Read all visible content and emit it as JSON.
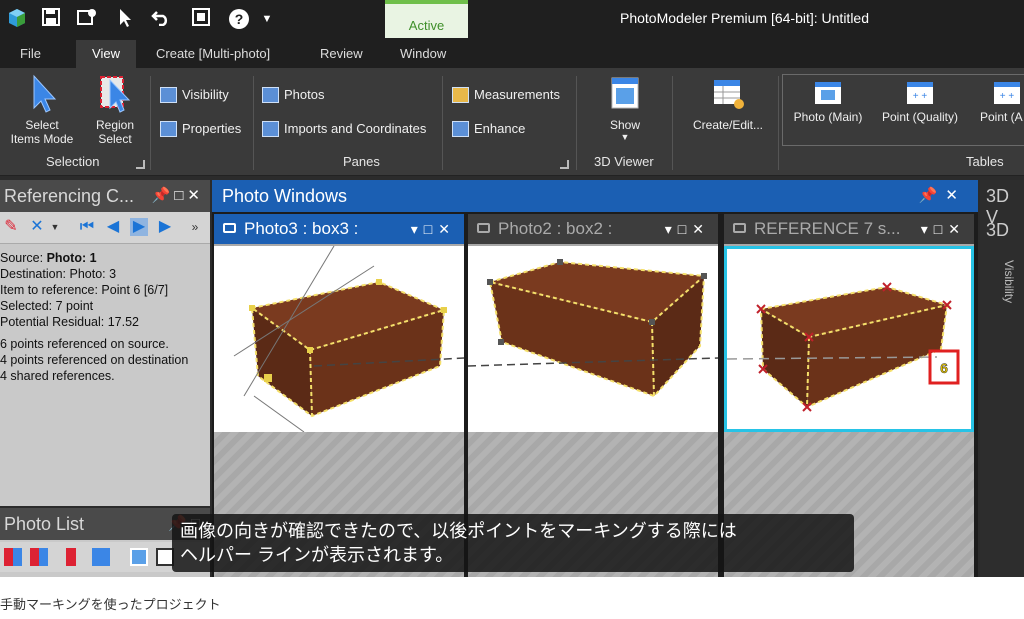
{
  "window": {
    "title": "PhotoModeler Premium [64-bit]: Untitled",
    "context_tab": "Active"
  },
  "quick_access": [
    "app-logo-icon",
    "save-icon",
    "save-photo-icon",
    "pointer-icon",
    "undo-icon",
    "window-icon",
    "help-icon",
    "dropdown-icon"
  ],
  "menu": {
    "tabs": [
      {
        "label": "File"
      },
      {
        "label": "View"
      },
      {
        "label": "Create  [Multi-photo]"
      },
      {
        "label": "Review"
      },
      {
        "label": "Window"
      }
    ],
    "selected": "View"
  },
  "ribbon": {
    "selection": {
      "select_items_line1": "Select",
      "select_items_line2": "Items Mode",
      "region_select_line1": "Region",
      "region_select_line2": "Select",
      "group_label": "Selection"
    },
    "panes": {
      "visibility": "Visibility",
      "properties": "Properties",
      "photos": "Photos",
      "imports": "Imports and Coordinates",
      "measurements": "Measurements",
      "enhance": "Enhance",
      "group_label": "Panes"
    },
    "viewer": {
      "show": "Show",
      "group_label": "3D Viewer"
    },
    "create_edit": "Create/Edit...",
    "tables": {
      "photo_main": "Photo (Main)",
      "point_quality": "Point (Quality)",
      "point_a": "Point (A",
      "group_label": "Tables"
    }
  },
  "referencing": {
    "title": "Referencing C...",
    "source_label": "Source: ",
    "source_value": "Photo: 1",
    "destination": "Destination:   Photo: 3",
    "item_to_reference": "Item to reference:  Point 6   [6/7]",
    "selected": "Selected: 7 point",
    "potential_residual": "Potential Residual: 17.52",
    "points_source": "6 points referenced on source.",
    "points_destination": "4 points referenced on destination",
    "shared_refs": "4 shared references."
  },
  "photo_list": {
    "title": "Photo List"
  },
  "photo_windows": {
    "title": "Photo Windows",
    "panes": [
      {
        "title": "Photo3 : box3 :"
      },
      {
        "title": "Photo2 : box2 :"
      },
      {
        "title": "REFERENCE 7 s..."
      }
    ],
    "marker_label": "6"
  },
  "right_edge": {
    "title1": "3D V",
    "title2": "3D",
    "visibility_tab": "Visibility"
  },
  "subtitle": {
    "line1": "画像の向きが確認できたので、以後ポイントをマーキングする際には",
    "line2": "ヘルパー ラインが表示されます。"
  },
  "caption": "手動マーキングを使ったプロジェクト",
  "colors": {
    "accent_blue": "#1b5fb3",
    "active_tab_green": "#6fbf4a",
    "selection_cyan": "#27c3e6",
    "marker_red": "#e02020"
  }
}
